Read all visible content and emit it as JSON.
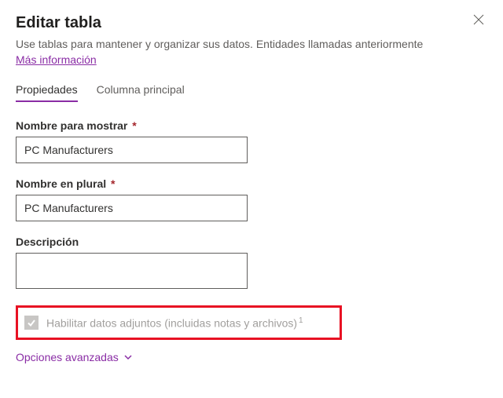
{
  "header": {
    "title": "Editar tabla",
    "subtitle": "Use tablas para mantener y organizar sus datos. Entidades llamadas anteriormente",
    "link": "Más información"
  },
  "tabs": {
    "properties": "Propiedades",
    "primaryColumn": "Columna principal"
  },
  "fields": {
    "displayName": {
      "label": "Nombre para mostrar",
      "value": "PC Manufacturers"
    },
    "pluralName": {
      "label": "Nombre en plural",
      "value": "PC Manufacturers"
    },
    "description": {
      "label": "Descripción",
      "value": ""
    },
    "attachments": {
      "label": "Habilitar datos adjuntos (incluidas notas y archivos)",
      "footnote": "1"
    }
  },
  "advanced": {
    "label": "Opciones avanzadas"
  },
  "requiredMark": "*"
}
